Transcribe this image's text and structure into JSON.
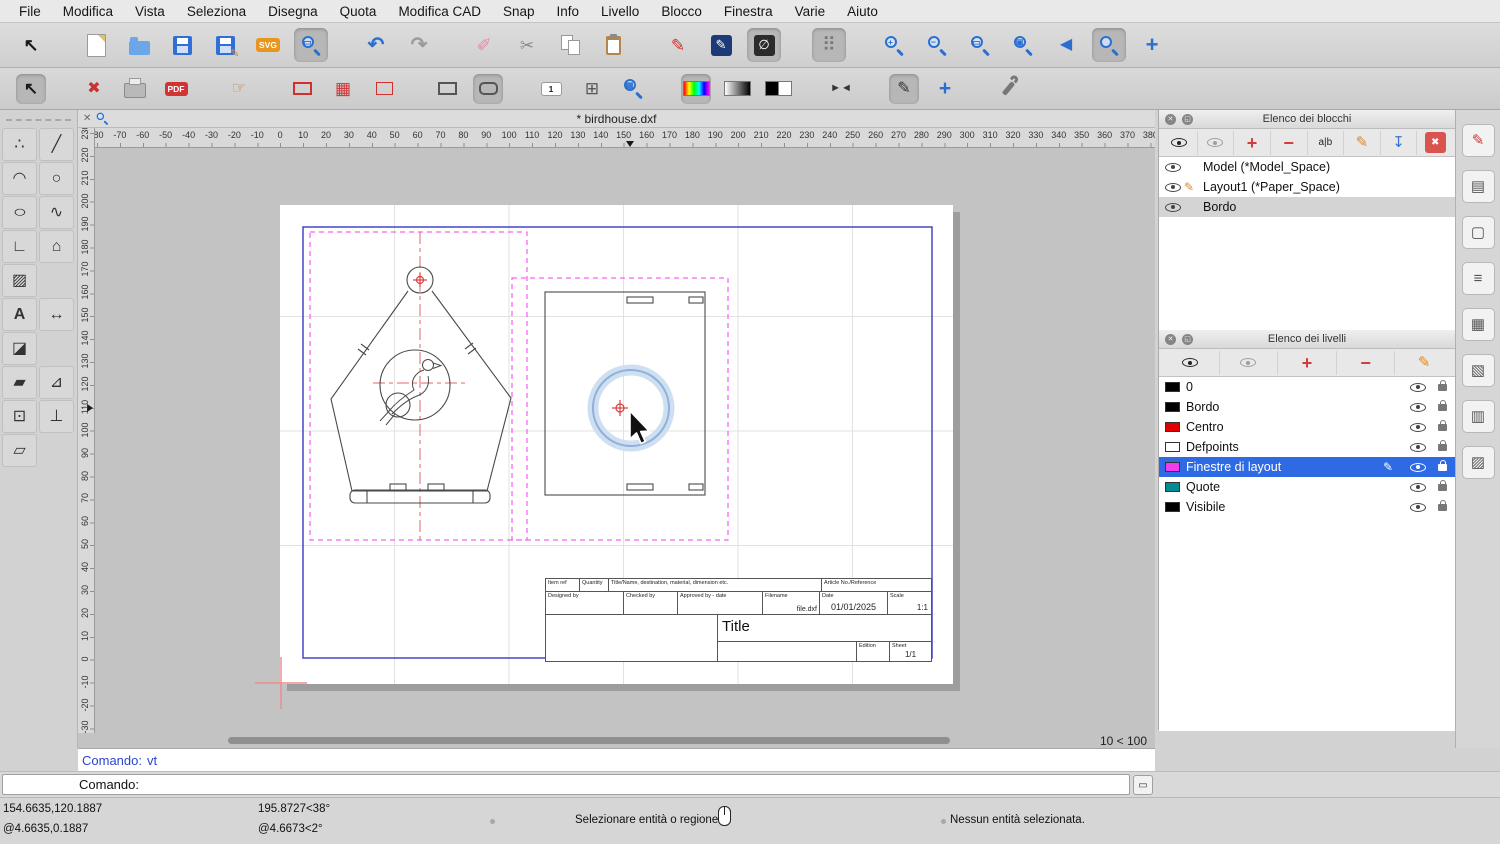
{
  "menubar": {
    "items": [
      "File",
      "Modifica",
      "Vista",
      "Seleziona",
      "Disegna",
      "Quota",
      "Modifica CAD",
      "Snap",
      "Info",
      "Livello",
      "Blocco",
      "Finestra",
      "Varie",
      "Aiuto"
    ]
  },
  "window": {
    "doc_title": "* birdhouse.dxf",
    "zoom_indicator": "10 < 100"
  },
  "toolbar_main": {
    "buttons": [
      {
        "name": "selection-tool-button",
        "glyph": "↖",
        "fg": "#1a1a1a",
        "size": 18,
        "bold": true
      },
      {
        "gap": true
      },
      {
        "name": "new-file-button",
        "kind": "file"
      },
      {
        "name": "open-file-button",
        "kind": "folder"
      },
      {
        "name": "save-button",
        "kind": "floppy"
      },
      {
        "name": "save-as-button",
        "kind": "floppy-edit"
      },
      {
        "name": "svg-export-button",
        "kind": "badge",
        "text": "SVG",
        "bg": "#e8971e"
      },
      {
        "name": "print-preview-button",
        "kind": "mag",
        "sub": "▭",
        "pressed": true
      },
      {
        "gap": true
      },
      {
        "name": "undo-button",
        "glyph": "↶",
        "fg": "#2a6fd0",
        "size": 20,
        "bold": true
      },
      {
        "name": "redo-button",
        "glyph": "↷",
        "fg": "#9a9a9a",
        "size": 20,
        "bold": true
      },
      {
        "gap": true
      },
      {
        "name": "erase-button",
        "glyph": "✐",
        "fg": "#e589a0",
        "size": 18
      },
      {
        "name": "cut-button",
        "glyph": "✂",
        "fg": "#8a8a8a",
        "size": 17
      },
      {
        "name": "copy-button",
        "kind": "pages"
      },
      {
        "name": "paste-button",
        "kind": "clip"
      },
      {
        "gap": true
      },
      {
        "name": "modify-button",
        "glyph": "✎",
        "fg": "#d03030",
        "size": 17
      },
      {
        "name": "edit-properties-button",
        "kind": "darkbox",
        "glyph": "✎",
        "boxbg": "#1d3a78"
      },
      {
        "name": "restrict-nothing-button",
        "kind": "darkbox",
        "glyph": "∅",
        "boxbg": "#2b2b2b",
        "pressed": true
      },
      {
        "gap": true
      },
      {
        "name": "snap-grid-button",
        "glyph": "⠿",
        "fg": "#777777",
        "size": 19,
        "pressed": true
      },
      {
        "gap": true
      },
      {
        "name": "zoom-in-button",
        "kind": "mag",
        "sub": "+"
      },
      {
        "name": "zoom-out-button",
        "kind": "mag",
        "sub": "−"
      },
      {
        "name": "auto-zoom-button",
        "kind": "mag",
        "sub": "▭"
      },
      {
        "name": "zoom-selection-button",
        "kind": "mag",
        "sub": "▣"
      },
      {
        "name": "previous-view-button",
        "glyph": "◀",
        "fg": "#2a6fd0",
        "size": 16
      },
      {
        "name": "zoom-window-button",
        "kind": "mag",
        "pressed": true
      },
      {
        "name": "pan-button",
        "glyph": "+",
        "fg": "#2a6fd0",
        "size": 22,
        "bold": true
      }
    ]
  },
  "toolbar_secondary": {
    "buttons": [
      {
        "name": "selection-tool-2-button",
        "glyph": "↖",
        "fg": "#1a1a1a",
        "size": 17,
        "bold": true,
        "pressed": true
      },
      {
        "gap": true
      },
      {
        "name": "close-drawing-button",
        "glyph": "✖",
        "fg": "#c83232",
        "size": 16
      },
      {
        "name": "print-export-button",
        "kind": "printer"
      },
      {
        "name": "pdf-export-button",
        "kind": "badge",
        "text": "PDF",
        "bg": "#d23333"
      },
      {
        "gap": true
      },
      {
        "name": "pan-hand-button",
        "glyph": "☞",
        "fg": "#b5854f",
        "size": 16
      },
      {
        "gap": true
      },
      {
        "name": "viewport-frame-button",
        "kind": "rect",
        "stroke": "#d03030"
      },
      {
        "name": "viewport-grid-button",
        "glyph": "▦",
        "fg": "#d03030",
        "size": 17
      },
      {
        "name": "viewport-center-button",
        "kind": "crossbox"
      },
      {
        "gap": true
      },
      {
        "name": "rectangle-mode-button",
        "kind": "rect",
        "stroke": "#555555"
      },
      {
        "name": "rounded-rect-button",
        "kind": "rect",
        "stroke": "#555555",
        "rounded": true,
        "pressed": true
      },
      {
        "gap": true
      },
      {
        "name": "scale-one-button",
        "kind": "badge",
        "text": "1",
        "bg": "#ffffff",
        "fg": "#222222",
        "border": true
      },
      {
        "name": "add-grid-button",
        "glyph": "⊞",
        "fg": "#555555",
        "size": 17
      },
      {
        "name": "zoom-grid-button",
        "kind": "mag",
        "sub": "▦"
      },
      {
        "gap": true
      },
      {
        "name": "full-color-button",
        "kind": "colorbar",
        "pressed": true
      },
      {
        "name": "grayscale-button",
        "kind": "graybar"
      },
      {
        "name": "black-white-button",
        "kind": "bwbar"
      },
      {
        "gap": true
      },
      {
        "name": "fit-width-button",
        "glyph": "►◄",
        "fg": "#333333",
        "size": 11,
        "bold": true
      },
      {
        "gap": true
      },
      {
        "name": "draft-mode-button",
        "glyph": "✎",
        "fg": "#333333",
        "size": 16,
        "pressed": true
      },
      {
        "name": "crosshair-button",
        "glyph": "+",
        "fg": "#2a6fd0",
        "size": 21,
        "bold": true
      },
      {
        "gap": true
      },
      {
        "name": "settings-button",
        "kind": "wrench"
      }
    ]
  },
  "tool_palette": {
    "rows": [
      [
        {
          "name": "point-tools-button",
          "glyph": "∴"
        },
        {
          "name": "line-tools-button",
          "glyph": "╱"
        }
      ],
      [
        {
          "name": "arc-tools-button",
          "glyph": "◠"
        },
        {
          "name": "circle-tools-button",
          "glyph": "○"
        }
      ],
      [
        {
          "name": "ellipse-tools-button",
          "glyph": "○",
          "stretch": true
        },
        {
          "name": "spline-tools-button",
          "glyph": "∿"
        }
      ],
      [
        {
          "name": "polyline-tools-button",
          "glyph": "∟"
        },
        {
          "name": "polygon-tools-button",
          "glyph": "⌂"
        }
      ],
      [
        {
          "name": "hatch-tool-button",
          "glyph": "▨"
        },
        null
      ],
      [
        {
          "name": "text-tool-button",
          "glyph": "A",
          "bold": true
        },
        {
          "name": "dimension-tools-button",
          "glyph": "↔"
        }
      ],
      [
        {
          "name": "image-tool-button",
          "glyph": "◪"
        },
        null
      ],
      [
        {
          "name": "solid-fill-button",
          "glyph": "▰"
        },
        {
          "name": "measure-tools-button",
          "glyph": "⊿"
        }
      ],
      [
        {
          "name": "shape-tools-button",
          "glyph": "⊡"
        },
        {
          "name": "snap-perpendicular-button",
          "glyph": "⊥"
        }
      ],
      [
        {
          "name": "isometric-view-button",
          "glyph": "▱"
        },
        null
      ]
    ]
  },
  "rulers": {
    "h": {
      "start": -80,
      "end": 380,
      "step": 10
    },
    "v": {
      "start": -30,
      "end": 230,
      "step": 10
    }
  },
  "blocks_panel": {
    "title": "Elenco dei blocchi",
    "toolbar": [
      {
        "name": "show-all-blocks-button",
        "kind": "eye",
        "fg": "#222222"
      },
      {
        "name": "hide-all-blocks-button",
        "kind": "eye",
        "fg": "#9e9e9e"
      },
      {
        "name": "add-block-button",
        "glyph": "+",
        "fg": "#d23b3b",
        "size": 18,
        "bold": true
      },
      {
        "name": "remove-block-button",
        "glyph": "−",
        "fg": "#d23b3b",
        "size": 18,
        "bold": true
      },
      {
        "name": "rename-block-button",
        "glyph": "a|b",
        "fg": "#222222",
        "size": 10
      },
      {
        "name": "edit-block-button",
        "glyph": "✎",
        "fg": "#e0882a",
        "size": 15
      },
      {
        "name": "insert-block-button",
        "glyph": "↧",
        "fg": "#3a6fd0",
        "size": 15
      },
      {
        "name": "delete-block-button",
        "kind": "darkbox",
        "glyph": "✖",
        "boxbg": "#d9534f",
        "size": 10
      }
    ],
    "items": [
      {
        "label": "Model (*Model_Space)",
        "eye": true
      },
      {
        "label": "Layout1 (*Paper_Space)",
        "eye": true,
        "edited": true
      },
      {
        "label": "Bordo",
        "eye": true,
        "highlighted": true
      }
    ]
  },
  "layers_panel": {
    "title": "Elenco dei livelli",
    "toolbar": [
      {
        "name": "show-all-layers-button",
        "kind": "eye",
        "fg": "#222222"
      },
      {
        "name": "hide-all-layers-button",
        "kind": "eye",
        "fg": "#9e9e9e"
      },
      {
        "name": "add-layer-button",
        "glyph": "+",
        "fg": "#d23b3b",
        "size": 18,
        "bold": true
      },
      {
        "name": "remove-layer-button",
        "glyph": "−",
        "fg": "#d23b3b",
        "size": 18,
        "bold": true
      },
      {
        "name": "edit-layer-button",
        "glyph": "✎",
        "fg": "#e0882a",
        "size": 15
      }
    ],
    "items": [
      {
        "label": "0",
        "color": "#000000"
      },
      {
        "label": "Bordo",
        "color": "#000000"
      },
      {
        "label": "Centro",
        "color": "#e00000"
      },
      {
        "label": "Defpoints",
        "color": "#ffffff"
      },
      {
        "label": "Finestre di layout",
        "color": "#ef3cef",
        "selected": true
      },
      {
        "label": "Quote",
        "color": "#008c91"
      },
      {
        "label": "Visibile",
        "color": "#000000"
      }
    ]
  },
  "side_strip": {
    "buttons": [
      {
        "name": "property-editor-panel-button",
        "glyph": "✎",
        "fg": "#c23b3b"
      },
      {
        "name": "block-list-panel-button",
        "glyph": "▤",
        "fg": "#555555"
      },
      {
        "name": "library-browser-panel-button",
        "glyph": "▢",
        "fg": "#555555"
      },
      {
        "name": "command-history-panel-button",
        "glyph": "≡",
        "fg": "#555555"
      },
      {
        "name": "layer-list-panel-button",
        "glyph": "▦",
        "fg": "#555555"
      },
      {
        "name": "selection-filter-panel-button",
        "glyph": "▧",
        "fg": "#555555"
      },
      {
        "name": "clipboard-panel-button",
        "glyph": "▥",
        "fg": "#555555"
      },
      {
        "name": "scripts-panel-button",
        "glyph": "▨",
        "fg": "#555555"
      }
    ]
  },
  "title_block": {
    "item_ref": "Item ref",
    "quantity": "Quantity",
    "title_name": "Title/Name, destination, material, dimension etc.",
    "article_no": "Article No./Reference",
    "designed_by": "Designed by",
    "checked_by": "Checked by",
    "approved_by": "Approved by - date",
    "filename_label": "Filename",
    "filename_value": "file.dxf",
    "date_label": "Date",
    "date_value": "01/01/2025",
    "scale_label": "Scale",
    "scale_value": "1:1",
    "title": "Title",
    "edition_label": "Edition",
    "sheet_label": "Sheet",
    "sheet_value": "1/1"
  },
  "command": {
    "history_label": "Comando:",
    "history_value": "vt",
    "prompt_label": "Comando:"
  },
  "statusbar": {
    "abs_coord": "154.6635,120.1887",
    "rel_coord": "@4.6635,0.1887",
    "polar_abs": "195.8727<38°",
    "polar_rel": "@4.6673<2°",
    "hint": "Selezionare entità o regione",
    "selection_status": "Nessun entità selezionata."
  }
}
